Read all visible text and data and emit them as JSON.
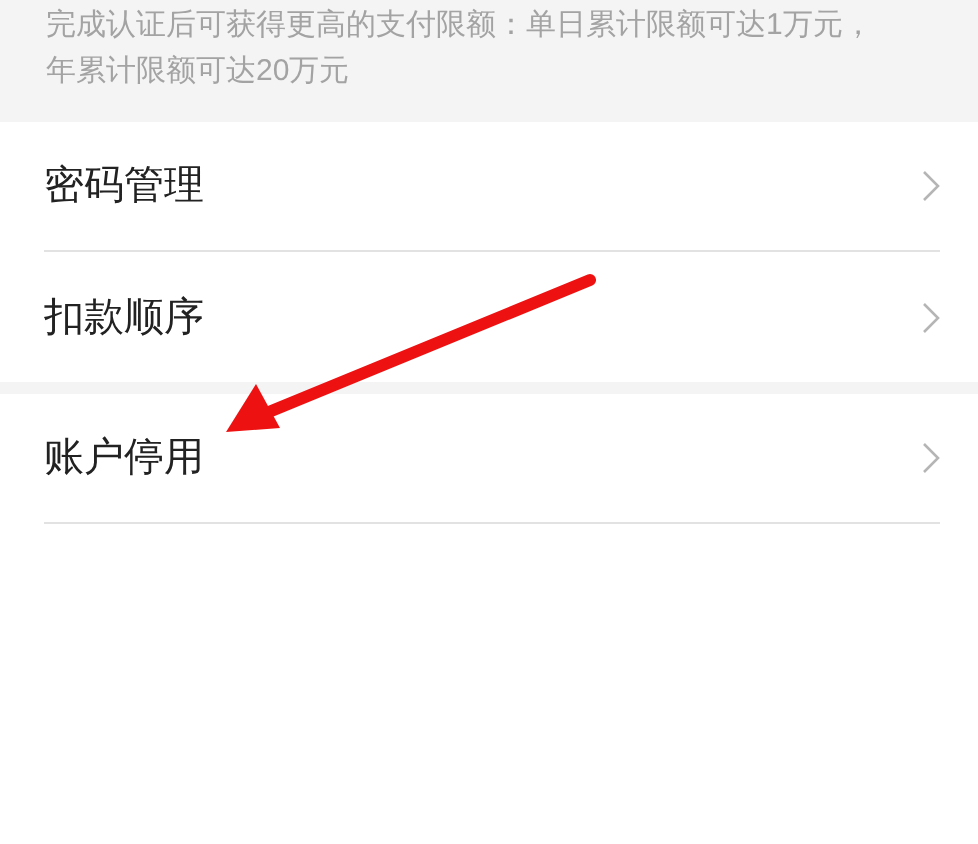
{
  "notice": "完成认证后可获得更高的支付限额：单日累计限额可达1万元，年累计限额可达20万元",
  "sections": [
    {
      "items": [
        {
          "label": "密码管理"
        },
        {
          "label": "扣款顺序"
        }
      ]
    },
    {
      "items": [
        {
          "label": "账户停用"
        }
      ]
    }
  ]
}
